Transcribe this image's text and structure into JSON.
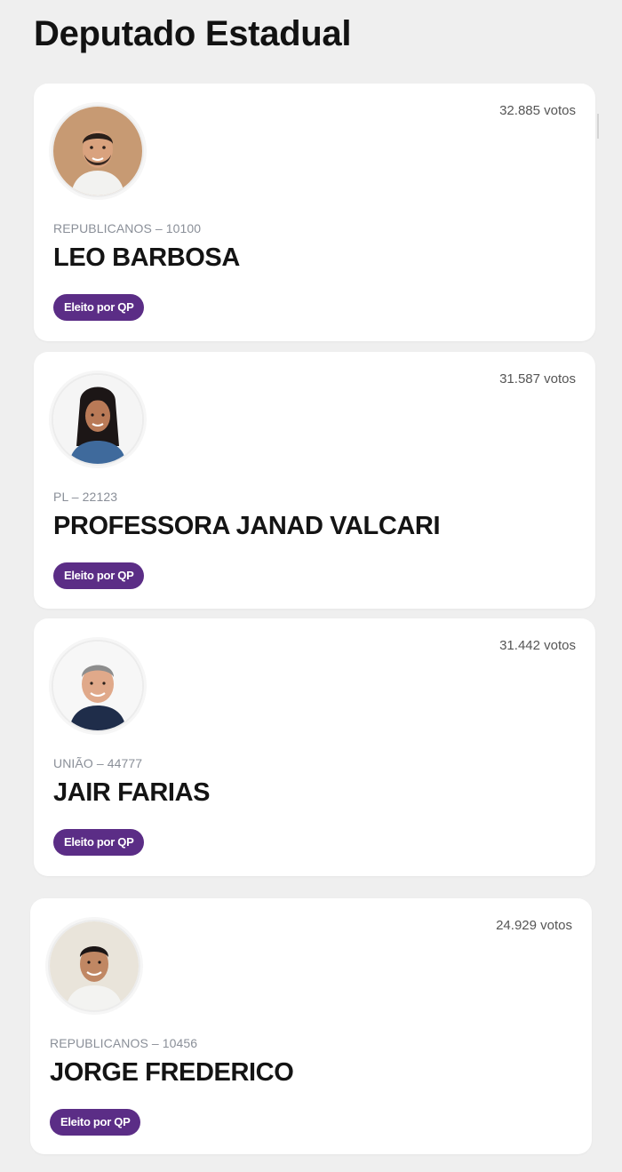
{
  "page": {
    "title": "Deputado Estadual"
  },
  "candidates": [
    {
      "votes": "32.885 votos",
      "party": "REPUBLICANOS – 10100",
      "name": "LEO BARBOSA",
      "status": "Eleito por QP"
    },
    {
      "votes": "31.587 votos",
      "party": "PL – 22123",
      "name": "PROFESSORA JANAD VALCARI",
      "status": "Eleito por QP"
    },
    {
      "votes": "31.442 votos",
      "party": "UNIÃO – 44777",
      "name": "JAIR FARIAS",
      "status": "Eleito por QP"
    },
    {
      "votes": "24.929 votos",
      "party": "REPUBLICANOS – 10456",
      "name": "JORGE FREDERICO",
      "status": "Eleito por QP"
    }
  ],
  "colors": {
    "page_background": "#efefef",
    "card_background": "#ffffff",
    "badge_background": "#5b2d86",
    "badge_text": "#ffffff",
    "party_text": "#8a8f98"
  }
}
